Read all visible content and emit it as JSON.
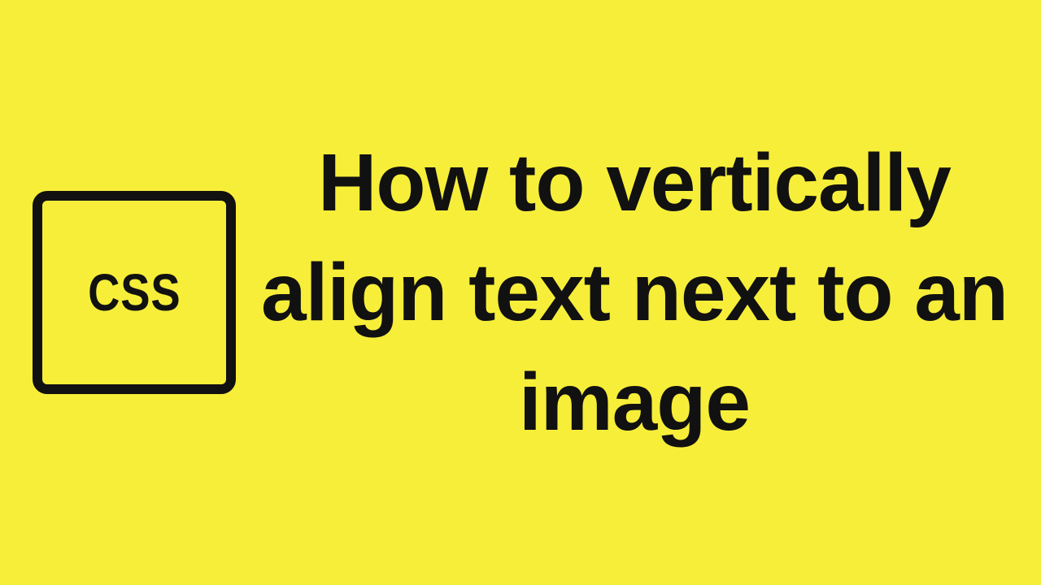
{
  "badge": {
    "label": "CSS"
  },
  "title": {
    "text": "How to vertically align text next to an image"
  },
  "colors": {
    "background": "#f7ee3a",
    "foreground": "#111111"
  }
}
